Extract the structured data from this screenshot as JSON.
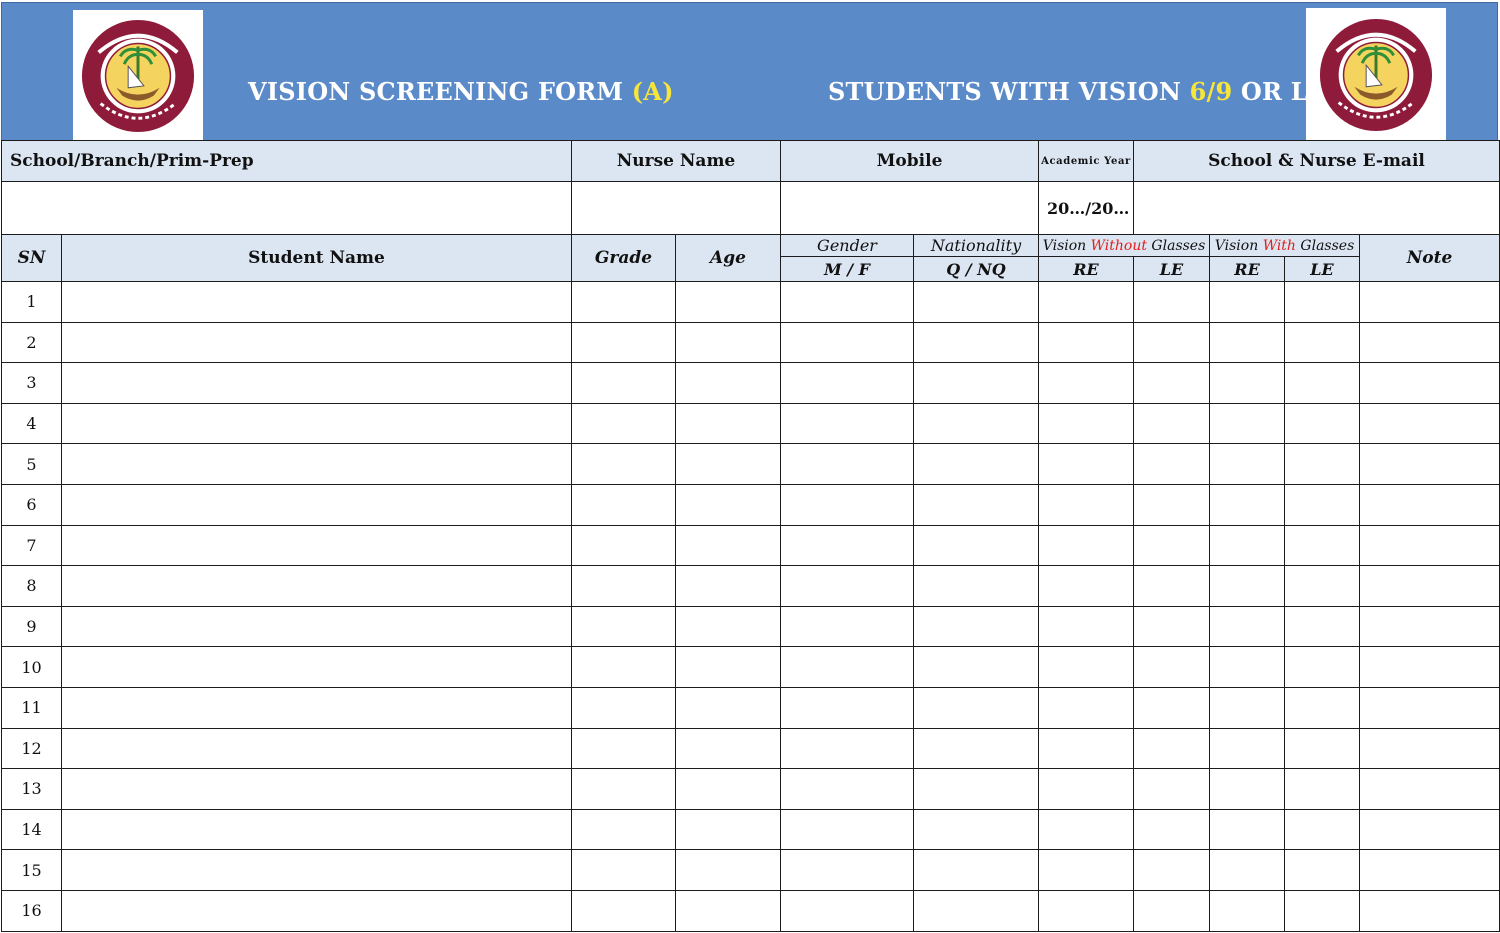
{
  "header": {
    "title_left_prefix": "VISION SCREENING FORM ",
    "title_left_highlight": "(A)",
    "title_right_prefix": "STUDENTS WITH VISION ",
    "title_right_highlight": "6/9",
    "title_right_suffix": " OR LESS",
    "logos": [
      {
        "name": "state-of-qatar-ministry-of-education-seal",
        "text": "State Of Qatar"
      },
      {
        "name": "state-of-qatar-ministry-of-public-health-seal",
        "text": ""
      }
    ],
    "colors": {
      "banner": "#5b8ac9",
      "highlight": "#f7e53b",
      "header_fill": "#dce6f2",
      "red_text": "#e1201c"
    }
  },
  "info": {
    "school_label": "School/Branch/Prim-Prep",
    "nurse_label": "Nurse Name",
    "mobile_label": "Mobile",
    "academic_year_label": "Academic Year",
    "email_label": "School & Nurse E-mail",
    "academic_year_value": "20…/20…"
  },
  "table": {
    "columns": {
      "sn": "SN",
      "student_name": "Student Name",
      "grade": "Grade",
      "age": "Age",
      "gender": "Gender",
      "gender_sub": "M / F",
      "nationality": "Nationality",
      "nationality_sub": "Q  /  NQ",
      "vision_without_prefix": "Vision ",
      "vision_without_red": "Without",
      "vision_without_suffix": " Glasses",
      "vision_with_prefix": "Vision ",
      "vision_with_red": "With",
      "vision_with_suffix": " Glasses",
      "re": "RE",
      "le": "LE",
      "note": "Note"
    },
    "rows": [
      "1",
      "2",
      "3",
      "4",
      "5",
      "6",
      "7",
      "8",
      "9",
      "10",
      "11",
      "12",
      "13",
      "14",
      "15",
      "16"
    ]
  }
}
